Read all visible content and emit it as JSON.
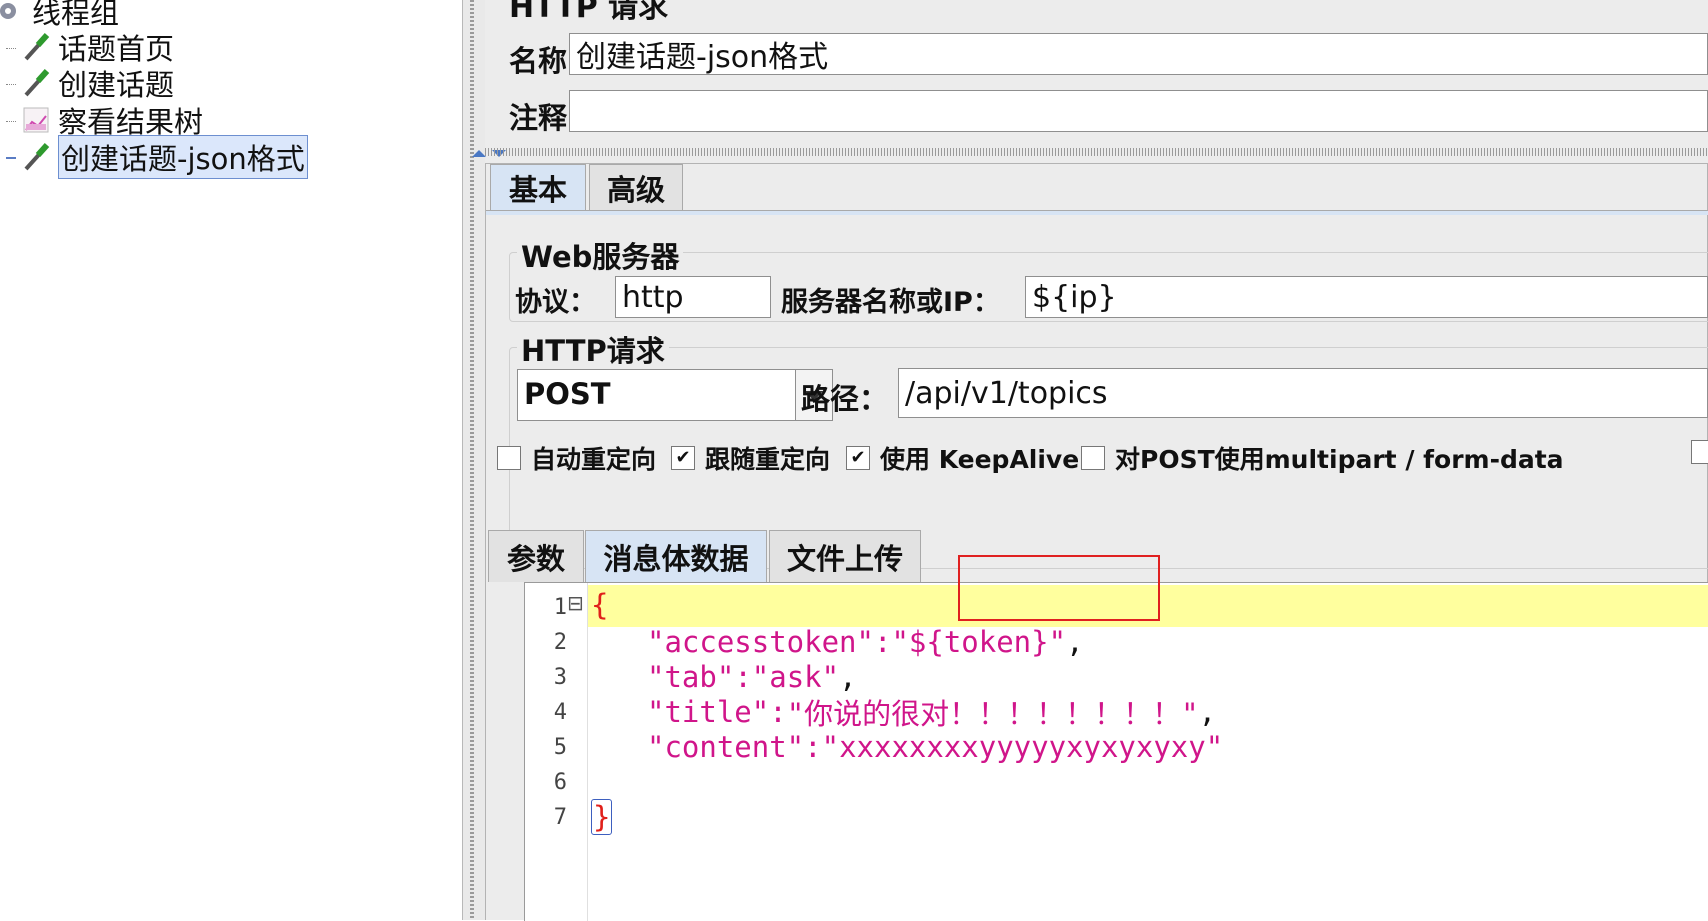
{
  "tree": {
    "parent_label": "线程组",
    "items": [
      {
        "label": "话题首页",
        "icon": "pipette-sampler-icon"
      },
      {
        "label": "创建话题",
        "icon": "pipette-sampler-icon"
      },
      {
        "label": "察看结果树",
        "icon": "chart-listener-icon"
      },
      {
        "label": "创建话题-json格式",
        "icon": "pipette-sampler-icon",
        "selected": true
      }
    ]
  },
  "panel": {
    "title": "HTTP 请求",
    "name_label": "名称：",
    "name_value": "创建话题-json格式",
    "comment_label": "注释：",
    "comment_value": ""
  },
  "tabs": {
    "basic": "基本",
    "advanced": "高级"
  },
  "web_server": {
    "group_title": "Web服务器",
    "protocol_label": "协议：",
    "protocol_value": "http",
    "server_label": "服务器名称或IP：",
    "server_value": "${ip}"
  },
  "http_request": {
    "group_title": "HTTP请求",
    "method": "POST",
    "path_label": "路径：",
    "path_value": "/api/v1/topics"
  },
  "options": [
    {
      "label": "自动重定向",
      "checked": false
    },
    {
      "label": "跟随重定向",
      "checked": true
    },
    {
      "label": "使用 KeepAlive",
      "checked": true
    },
    {
      "label": "对POST使用multipart / form-data",
      "checked": false
    }
  ],
  "body_tabs": {
    "params": "参数",
    "body": "消息体数据",
    "files": "文件上传"
  },
  "editor": {
    "line_numbers": [
      "1",
      "2",
      "3",
      "4",
      "5",
      "6",
      "7"
    ],
    "open_brace": "{",
    "close_brace": "}",
    "lines": [
      {
        "key": "\"accesstoken\"",
        "sep": ":",
        "value": "\"${token}\"",
        "trail": ","
      },
      {
        "key": "\"tab\"",
        "sep": ":",
        "value": "\"ask\"",
        "trail": ","
      },
      {
        "key": "\"title\"",
        "sep": ":",
        "value": "\"你说的很对！！！！！！！！\"",
        "trail": ","
      },
      {
        "key": "\"content\"",
        "sep": ":",
        "value": "\"xxxxxxxxyyyyyxyxyxyxy\"",
        "trail": ""
      }
    ],
    "fold_marker": "⊟",
    "highlight_color": "#ffff9e",
    "annotation_color": "#e02020"
  }
}
